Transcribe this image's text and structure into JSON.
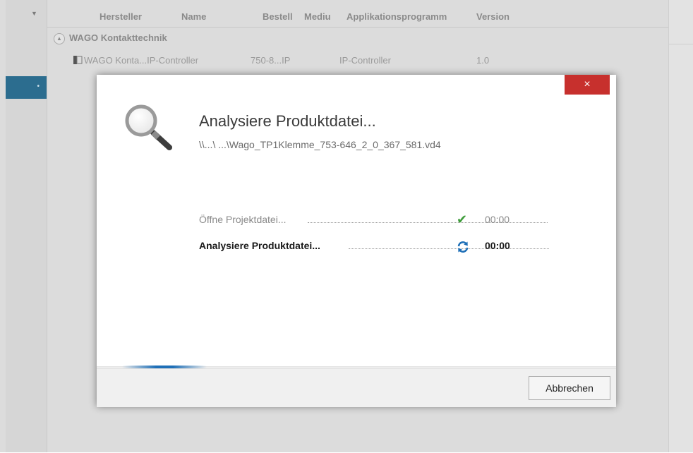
{
  "background": {
    "columns": [
      "Hersteller",
      "Name",
      "Bestell",
      "Mediu",
      "Applikationsprogramm",
      "Version"
    ],
    "group": "WAGO Kontakttechnik",
    "row": {
      "name": "WAGO Konta...IP-Controller",
      "order": "750-8...IP",
      "app": "IP-Controller",
      "version": "1.0"
    }
  },
  "dialog": {
    "title": "Analysiere Produktdatei...",
    "path": "\\\\...\\ ...\\Wago_TP1Klemme_753-646_2_0_367_581.vd4",
    "close_label": "×",
    "steps": [
      {
        "label": "Öffne Projektdatei...",
        "time": "00:00",
        "status": "done",
        "icon": "check-icon"
      },
      {
        "label": "Analysiere Produktdatei...",
        "time": "00:00",
        "status": "in-progress",
        "icon": "refresh-icon"
      }
    ],
    "cancel_label": "Abbrechen"
  },
  "colors": {
    "close": "#c7302d",
    "check": "#3e9c3a",
    "progress": "#1e6fb7",
    "selection": "#2c6d8f"
  }
}
